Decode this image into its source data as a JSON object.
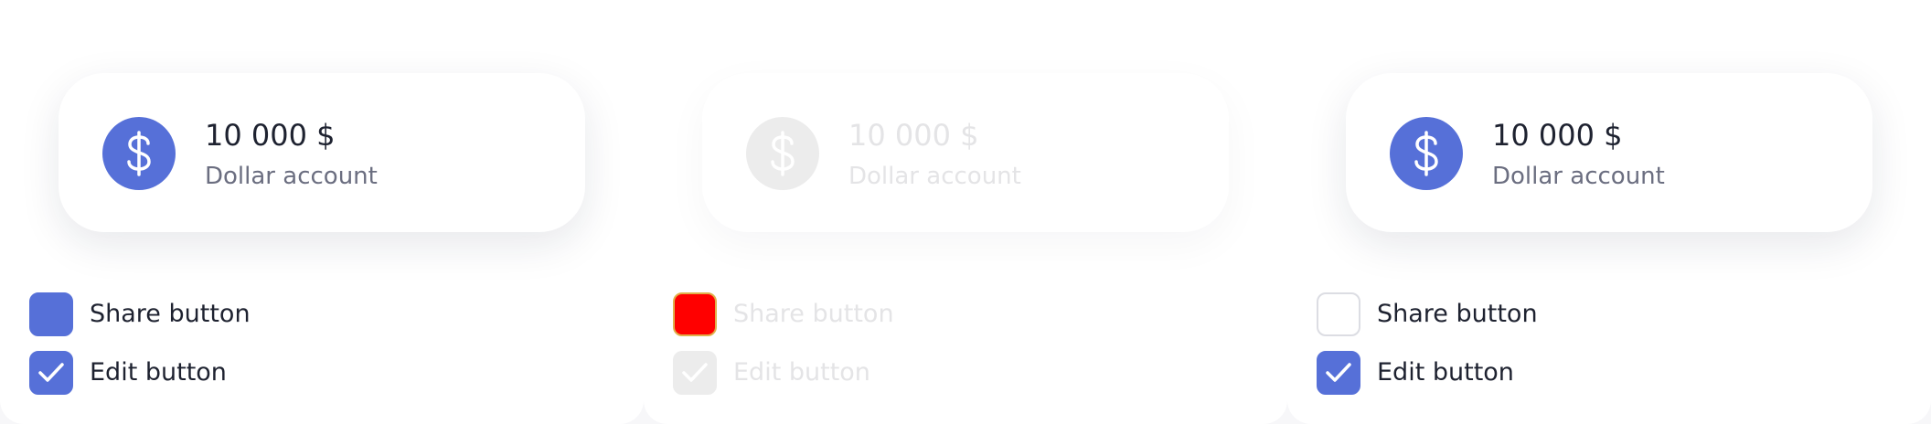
{
  "colors": {
    "accent": "#5670d8",
    "disabled": "#ececec",
    "highlight": "#ff0000",
    "text_primary": "#1e2230",
    "text_secondary": "#6b6e80"
  },
  "panels": [
    {
      "state": "default",
      "card": {
        "icon": "dollar-icon",
        "amount": "10 000 $",
        "label": "Dollar account"
      },
      "share_option": {
        "label": "Share button",
        "checked": false,
        "style": "filled"
      },
      "edit_option": {
        "label": "Edit button",
        "checked": true
      }
    },
    {
      "state": "disabled",
      "card": {
        "icon": "dollar-icon",
        "amount": "10 000 $",
        "label": "Dollar account"
      },
      "share_option": {
        "label": "Share button",
        "checked": false,
        "style": "highlighted"
      },
      "edit_option": {
        "label": "Edit button",
        "checked": true
      }
    },
    {
      "state": "default",
      "card": {
        "icon": "dollar-icon",
        "amount": "10 000 $",
        "label": "Dollar account"
      },
      "share_option": {
        "label": "Share button",
        "checked": false,
        "style": "empty"
      },
      "edit_option": {
        "label": "Edit button",
        "checked": true
      }
    }
  ]
}
